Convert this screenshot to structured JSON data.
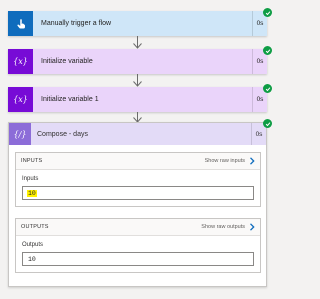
{
  "steps": [
    {
      "title": "Manually trigger a flow",
      "duration": "0s",
      "icon": "hand-touch-icon",
      "color": "#0f6cbd",
      "bg": "#cfe6f8"
    },
    {
      "title": "Initialize variable",
      "duration": "0s",
      "icon": "variable-icon",
      "color": "#770bd6",
      "bg": "#ead4fa"
    },
    {
      "title": "Initialize variable 1",
      "duration": "0s",
      "icon": "variable-icon",
      "color": "#770bd6",
      "bg": "#ead4fa"
    }
  ],
  "compose": {
    "title": "Compose - days",
    "duration": "0s",
    "icon": "compose-icon",
    "header_color": "#8c6cd8",
    "inputs": {
      "section_label": "INPUTS",
      "raw_link": "Show raw inputs",
      "field_label": "Inputs",
      "value": "10",
      "value_highlight": "#fff100"
    },
    "outputs": {
      "section_label": "OUTPUTS",
      "raw_link": "Show raw outputs",
      "field_label": "Outputs",
      "value": "10"
    }
  },
  "status": {
    "success_color": "#0e9d45",
    "icon": "success-check-icon"
  }
}
